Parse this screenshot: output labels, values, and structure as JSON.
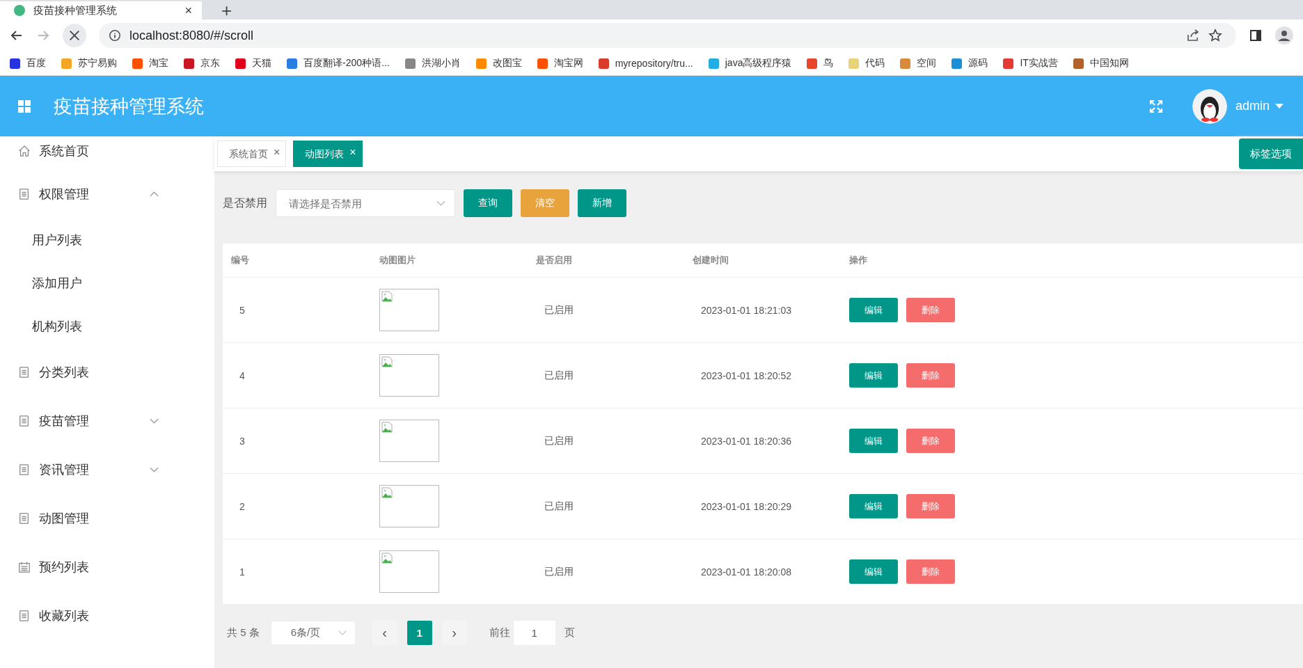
{
  "browser": {
    "tab_title": "疫苗接种管理系统",
    "tab_close": "×",
    "new_tab": "+",
    "address": "localhost:8080/#/scroll",
    "bookmarks": [
      {
        "label": "百度",
        "color": "#2932e1"
      },
      {
        "label": "苏宁易购",
        "color": "#f5a623"
      },
      {
        "label": "淘宝",
        "color": "#ff5000"
      },
      {
        "label": "京东",
        "color": "#c91623"
      },
      {
        "label": "天猫",
        "color": "#e0001b"
      },
      {
        "label": "百度翻译-200种语...",
        "color": "#2a7de1"
      },
      {
        "label": "洪湖小肖",
        "color": "#888888"
      },
      {
        "label": "改图宝",
        "color": "#ff8a00"
      },
      {
        "label": "淘宝网",
        "color": "#ff5000"
      },
      {
        "label": "myrepository/tru...",
        "color": "#d83b2a"
      },
      {
        "label": "java高级程序猿",
        "color": "#23ade5"
      },
      {
        "label": "鸟",
        "color": "#e8452c"
      },
      {
        "label": "代码",
        "color": "#e8d27a"
      },
      {
        "label": "空间",
        "color": "#d98a3a"
      },
      {
        "label": "源码",
        "color": "#1d8fd6"
      },
      {
        "label": "IT实战营",
        "color": "#e53935"
      },
      {
        "label": "中国知网",
        "color": "#b0622a"
      }
    ]
  },
  "header": {
    "title": "疫苗接种管理系统",
    "user": "admin"
  },
  "sidebar": {
    "items": [
      {
        "label": "系统首页",
        "kind": "home"
      },
      {
        "label": "权限管理",
        "kind": "page",
        "expanded": true,
        "children": [
          {
            "label": "用户列表"
          },
          {
            "label": "添加用户"
          },
          {
            "label": "机构列表"
          }
        ]
      },
      {
        "label": "分类列表",
        "kind": "page"
      },
      {
        "label": "疫苗管理",
        "kind": "page",
        "expanded": false
      },
      {
        "label": "资讯管理",
        "kind": "page",
        "expanded": false
      },
      {
        "label": "动图管理",
        "kind": "page"
      },
      {
        "label": "预约列表",
        "kind": "schedule"
      },
      {
        "label": "收藏列表",
        "kind": "page"
      }
    ]
  },
  "tabs": [
    {
      "label": "系统首页",
      "close": "×",
      "selected": false
    },
    {
      "label": "动图列表",
      "close": "×",
      "selected": true
    }
  ],
  "tab_options": "标签选项",
  "filter": {
    "label": "是否禁用",
    "placeholder": "请选择是否禁用",
    "buttons": [
      {
        "label": "查询",
        "kind": "primary"
      },
      {
        "label": "清空",
        "kind": "warning"
      },
      {
        "label": "新增",
        "kind": "primary"
      }
    ]
  },
  "table": {
    "columns": [
      "编号",
      "动图图片",
      "是否启用",
      "创建时间",
      "操作"
    ],
    "rows": [
      {
        "id": "5",
        "status": "已启用",
        "created": "2023-01-01 18:21:03",
        "actions": [
          "编辑",
          "删除"
        ]
      },
      {
        "id": "4",
        "status": "已启用",
        "created": "2023-01-01 18:20:52",
        "actions": [
          "编辑",
          "删除"
        ]
      },
      {
        "id": "3",
        "status": "已启用",
        "created": "2023-01-01 18:20:36",
        "actions": [
          "编辑",
          "删除"
        ]
      },
      {
        "id": "2",
        "status": "已启用",
        "created": "2023-01-01 18:20:29",
        "actions": [
          "编辑",
          "删除"
        ]
      },
      {
        "id": "1",
        "status": "已启用",
        "created": "2023-01-01 18:20:08",
        "actions": [
          "编辑",
          "删除"
        ]
      }
    ]
  },
  "pagination": {
    "total": "共 5 条",
    "page_size": "6条/页",
    "prev": "‹",
    "next": "›",
    "pages": [
      {
        "label": "1",
        "selected": true
      }
    ],
    "goto": "前往",
    "goto_value": "1",
    "goto_suffix": "页"
  }
}
